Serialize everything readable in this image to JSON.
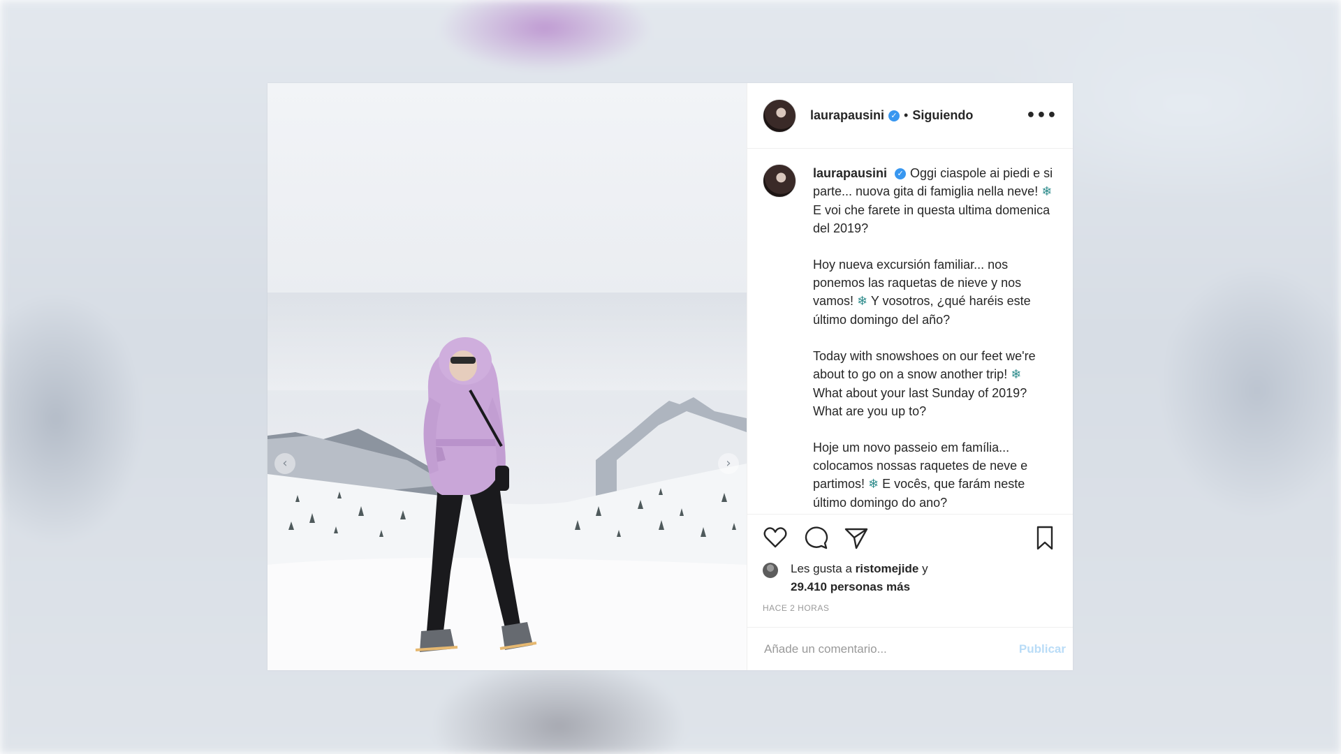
{
  "post": {
    "username": "laurapausini",
    "verified_icon": "verified-badge-icon",
    "separator": "•",
    "follow_status": "Siguiendo",
    "more_label": "•••"
  },
  "caption": {
    "username": "laurapausini",
    "snowflake": "❄",
    "p1_text": "Oggi ciaspole ai piedi e si parte... nuova gita di famiglia nella neve!",
    "p1_rest": "E voi che farete in questa ultima domenica del 2019?",
    "p2_text": "Hoy nueva excursión familiar... nos ponemos las raquetas de nieve y nos vamos!",
    "p2_rest": "Y vosotros, ¿qué haréis este último domingo del año?",
    "p3_text": "Today with snowshoes on our feet we're about to go on a snow another trip!",
    "p3_rest": "What about your last Sunday of 2019? What are you up to?",
    "p4_text": "Hoje um novo passeio em família... colocamos nossas raquetes de neve e partimos!",
    "p4_rest": "E vocês, que farám neste último domingo do ano?"
  },
  "carousel": {
    "prev": "‹",
    "next": "›"
  },
  "likes": {
    "prefix": "Les gusta a",
    "user": "ristomejide",
    "conjunction": "y",
    "count": "29.410 personas más"
  },
  "timestamp": "HACE 2 HORAS",
  "comment_box": {
    "placeholder": "Añade un comentario...",
    "submit_label": "Publicar"
  },
  "icons": [
    "heart-icon",
    "comment-icon",
    "share-icon",
    "bookmark-icon"
  ],
  "colors": {
    "verified": "#3897f0",
    "jacket": "#c9a6d8",
    "publish_disabled": "#b9dcf7"
  }
}
